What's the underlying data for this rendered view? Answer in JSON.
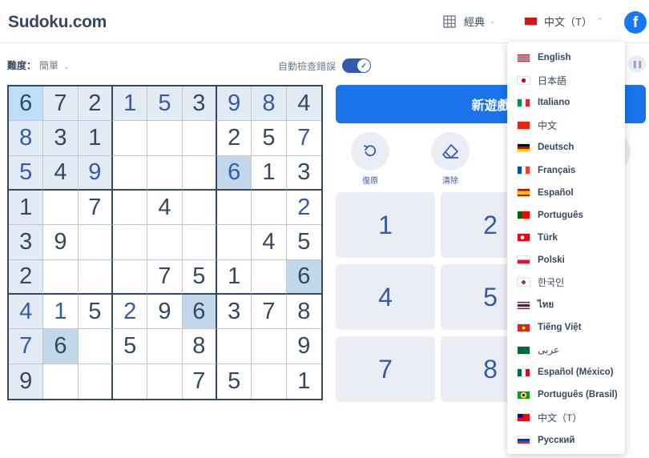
{
  "header": {
    "logo_main": "Sudoku",
    "logo_dot": ".",
    "logo_tld": "com",
    "mode_label": "經典",
    "language_label": "中文（T）",
    "facebook_label": "f"
  },
  "toolbar": {
    "difficulty_label": "難度：",
    "difficulty_value": "簡單",
    "autocheck_label": "自動檢查錯誤",
    "autocheck_on": true
  },
  "board": {
    "cells": [
      [
        6,
        7,
        2,
        1,
        5,
        3,
        9,
        8,
        4
      ],
      [
        8,
        3,
        1,
        null,
        null,
        null,
        2,
        5,
        7
      ],
      [
        5,
        4,
        9,
        null,
        null,
        null,
        6,
        1,
        3
      ],
      [
        1,
        null,
        7,
        null,
        4,
        null,
        null,
        null,
        2
      ],
      [
        3,
        9,
        null,
        null,
        null,
        null,
        null,
        4,
        5
      ],
      [
        2,
        null,
        null,
        null,
        7,
        5,
        1,
        null,
        6
      ],
      [
        4,
        1,
        5,
        2,
        9,
        6,
        3,
        7,
        8
      ],
      [
        7,
        6,
        null,
        5,
        null,
        8,
        null,
        null,
        9
      ],
      [
        9,
        null,
        null,
        null,
        null,
        7,
        5,
        null,
        1
      ]
    ],
    "user_entered": [
      [
        0,
        3
      ],
      [
        0,
        4
      ],
      [
        0,
        6
      ],
      [
        0,
        7
      ],
      [
        1,
        0
      ],
      [
        1,
        8
      ],
      [
        2,
        0
      ],
      [
        2,
        2
      ],
      [
        2,
        6
      ],
      [
        3,
        8
      ],
      [
        6,
        0
      ],
      [
        6,
        1
      ],
      [
        6,
        3
      ],
      [
        7,
        0
      ]
    ],
    "selected": [
      0,
      0
    ],
    "same_number": [
      [
        2,
        6
      ],
      [
        5,
        8
      ],
      [
        6,
        5
      ],
      [
        7,
        1
      ]
    ]
  },
  "controls": {
    "new_game_label": "新遊戲",
    "undo_label": "復原",
    "erase_label": "清除",
    "numbers": [
      "1",
      "2",
      "4",
      "5",
      "7",
      "8"
    ]
  },
  "language_menu": {
    "items": [
      {
        "label": "English",
        "flag": "us"
      },
      {
        "label": "日本語",
        "flag": "jp"
      },
      {
        "label": "Italiano",
        "flag": "it"
      },
      {
        "label": "中文",
        "flag": "cn"
      },
      {
        "label": "Deutsch",
        "flag": "de"
      },
      {
        "label": "Français",
        "flag": "fr"
      },
      {
        "label": "Español",
        "flag": "es"
      },
      {
        "label": "Português",
        "flag": "pt"
      },
      {
        "label": "Türk",
        "flag": "tr"
      },
      {
        "label": "Polski",
        "flag": "pl"
      },
      {
        "label": "한국인",
        "flag": "kr"
      },
      {
        "label": "ไทย",
        "flag": "th"
      },
      {
        "label": "Tiếng Việt",
        "flag": "vn"
      },
      {
        "label": "عربى",
        "flag": "sa"
      },
      {
        "label": "Español (México)",
        "flag": "mx"
      },
      {
        "label": "Português (Brasil)",
        "flag": "br"
      },
      {
        "label": "中文（T）",
        "flag": "tw"
      },
      {
        "label": "Русский",
        "flag": "ru"
      }
    ]
  },
  "colors": {
    "accent": "#325aaf",
    "primary_button": "#1a73e8",
    "text": "#344861"
  }
}
